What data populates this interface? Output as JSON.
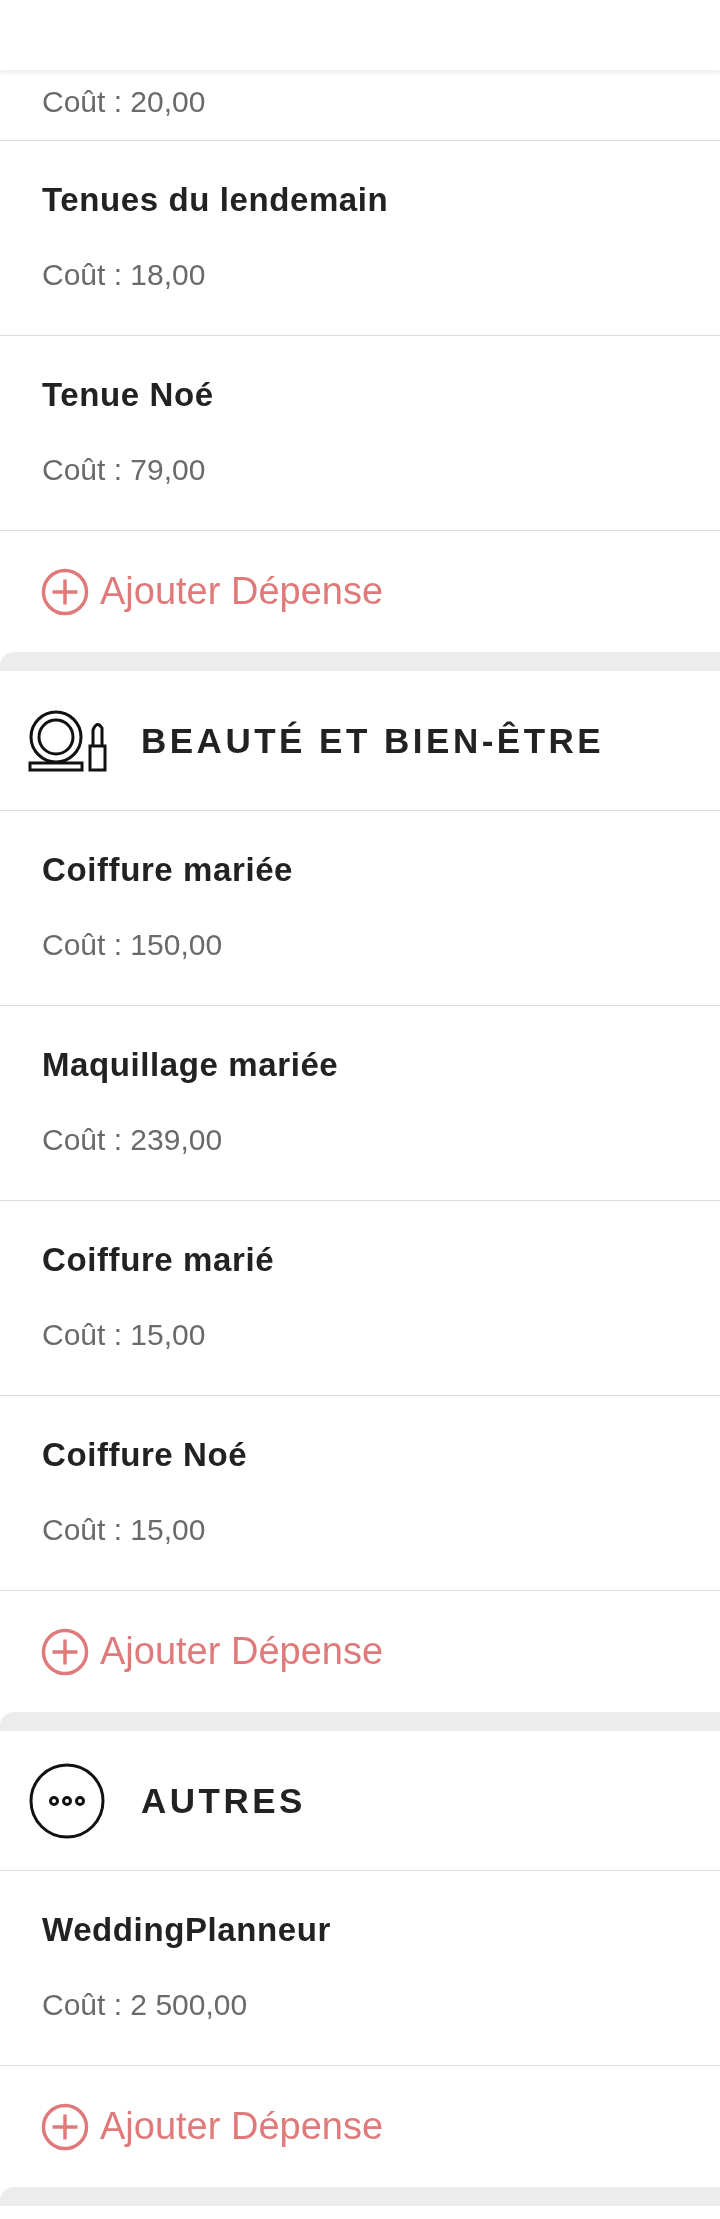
{
  "sections": [
    {
      "items": [
        {
          "cost": "Coût : 20,00"
        },
        {
          "name": "Tenues du lendemain",
          "cost": "Coût : 18,00"
        },
        {
          "name": "Tenue Noé",
          "cost": "Coût : 79,00"
        }
      ],
      "add_label": "Ajouter Dépense"
    },
    {
      "kind": "beauty",
      "title": "BEAUTÉ ET BIEN-ÊTRE",
      "items": [
        {
          "name": "Coiffure mariée",
          "cost": "Coût : 150,00"
        },
        {
          "name": "Maquillage mariée",
          "cost": "Coût : 239,00"
        },
        {
          "name": "Coiffure marié",
          "cost": "Coût : 15,00"
        },
        {
          "name": "Coiffure Noé",
          "cost": "Coût : 15,00"
        }
      ],
      "add_label": "Ajouter Dépense"
    },
    {
      "kind": "other",
      "title": "AUTRES",
      "items": [
        {
          "name": "WeddingPlanneur",
          "cost": "Coût : 2 500,00"
        }
      ],
      "add_label": "Ajouter Dépense"
    }
  ]
}
